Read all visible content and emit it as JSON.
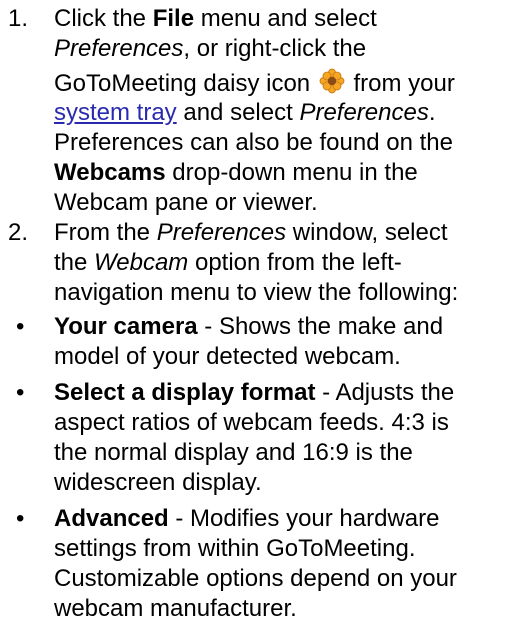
{
  "step1": {
    "number": "1.",
    "l1_pre": "Click the ",
    "l1_bold": "File",
    "l1_post": " menu and select",
    "l2_ital": "Preferences",
    "l2_post": ", or right-click the",
    "l3_pre": "GoToMeeting daisy icon",
    "l3_post": "from your",
    "l4_link": "system tray",
    "l4_mid": " and select ",
    "l4_ital": "Preferences",
    "l4_end": ".",
    "l5": "Preferences can also be found on the",
    "l6_bold": "Webcams",
    "l6_post": " drop-down menu in the",
    "l7": "Webcam pane or viewer."
  },
  "step2": {
    "number": "2.",
    "l1_pre": "From the ",
    "l1_ital": "Preferences",
    "l1_post": " window, select",
    "l2_pre": "the ",
    "l2_ital": "Webcam",
    "l2_post": " option from the left-",
    "l3": "navigation menu to view the following:"
  },
  "bullets": [
    {
      "marker": "•",
      "bold": "Your camera",
      "l1_post": " - Shows the make and",
      "l2": "model of your detected webcam."
    },
    {
      "marker": "•",
      "bold": "Select a display format",
      "l1_post": " - Adjusts the",
      "l2": "aspect ratios of webcam feeds. 4:3 is",
      "l3": "the normal display and 16:9 is the",
      "l4": "widescreen display."
    },
    {
      "marker": "•",
      "bold": "Advanced",
      "l1_post": " - Modifies your hardware",
      "l2": "settings from within GoToMeeting.",
      "l3": "Customizable options depend on your",
      "l4": "webcam manufacturer."
    }
  ],
  "colors": {
    "text": "#000000",
    "link": "#2a2ab0",
    "daisy_petals": "#f5a623",
    "daisy_center": "#8a4b16"
  },
  "icons": {
    "daisy": "gotomeeting-daisy-icon"
  }
}
